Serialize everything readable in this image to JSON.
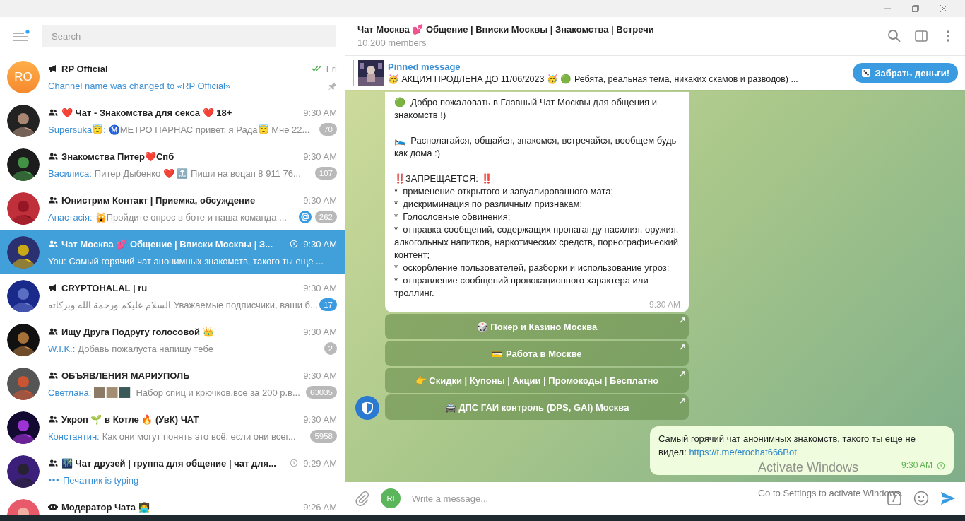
{
  "search": {
    "placeholder": "Search"
  },
  "menu": {
    "has_update": true
  },
  "chats": [
    {
      "name": "RP Official",
      "kind": "channel",
      "avatar": {
        "kind": "initials",
        "text": "RO"
      },
      "time": "Fri",
      "receipt": {
        "kind": "read"
      },
      "preview": {
        "kind": "service",
        "text": "Channel name was changed to «RP Official»"
      },
      "mention": false,
      "pinned": true,
      "selected": false
    },
    {
      "name": "❤️ Чат - Знакомства для секса ❤️ 18+",
      "kind": "group",
      "time": "9:30 AM",
      "preview": {
        "kind": "text",
        "sender": "Supersuka😇:",
        "text": "Ⓜ️МЕТРО ПАРНАС  привет, я Рада😇  Мне 22..."
      },
      "badge": "70",
      "badge_muted": true,
      "mention": false,
      "pinned": false,
      "selected": false
    },
    {
      "name": "Знакомства Питер❤️Спб",
      "kind": "group",
      "time": "9:30 AM",
      "preview": {
        "kind": "text",
        "sender": "Василиса:",
        "text": "Питер  Дыбенко ❤️ 🔝 Пиши на воцап  8 911 76..."
      },
      "badge": "107",
      "badge_muted": true,
      "mention": false,
      "pinned": false,
      "selected": false
    },
    {
      "name": "Юнистрим Контакт | Приемка, обсуждение",
      "kind": "group",
      "time": "9:30 AM",
      "preview": {
        "kind": "text",
        "sender": "Анастасія:",
        "text": "🙀Пройдите опрос в боте и наша команда ..."
      },
      "badge": "262",
      "badge_muted": true,
      "mention": true,
      "pinned": false,
      "selected": false
    },
    {
      "name": "Чат Москва 💕 Общение | Вписки Москвы | З...",
      "kind": "group",
      "time": "9:30 AM",
      "receipt": {
        "kind": "sending"
      },
      "preview": {
        "kind": "text",
        "sender": "You:",
        "text": "Самый горячий чат анонимных знакомств, такого ты еще ..."
      },
      "mention": false,
      "pinned": false,
      "selected": true
    },
    {
      "name": "CRYPTOHALAL | ru",
      "kind": "channel",
      "time": "9:30 AM",
      "preview": {
        "kind": "text",
        "text": "السلام عليكم ورحمة الله وبركاته  Уважаемые подписчики, ваши б..."
      },
      "badge": "17",
      "badge_muted": false,
      "mention": false,
      "pinned": false,
      "selected": false
    },
    {
      "name": "Ищу Друга Подругу голосовой 👑",
      "kind": "group",
      "time": "9:30 AM",
      "preview": {
        "kind": "text",
        "sender": "W.I.K.:",
        "text": "Добавь пожалуста напишу тебе"
      },
      "badge": "2",
      "badge_muted": true,
      "mention": false,
      "pinned": false,
      "selected": false
    },
    {
      "name": "ОБЪЯВЛЕНИЯ МАРИУПОЛЬ",
      "kind": "group",
      "time": "9:30 AM",
      "preview": {
        "kind": "media",
        "sender": "Светлана:",
        "text": "Набор спиц и крючков.все за 200 р.в..."
      },
      "badge": "63035",
      "badge_muted": true,
      "mention": false,
      "pinned": false,
      "selected": false
    },
    {
      "name": "Укроп 🌱 в Котле 🔥 (УвК) ЧАТ",
      "kind": "group",
      "time": "9:30 AM",
      "preview": {
        "kind": "text",
        "sender": "Константин:",
        "text": "Как они могут понять это всё, если они всег..."
      },
      "badge": "5958",
      "badge_muted": true,
      "mention": false,
      "pinned": false,
      "selected": false
    },
    {
      "name": "🌃 Чат друзей | группа для общение | чат для...",
      "kind": "group",
      "time": "9:29 AM",
      "receipt": {
        "kind": "sending"
      },
      "preview": {
        "kind": "typing",
        "text": "Печатник is typing"
      },
      "mention": false,
      "pinned": false,
      "selected": false
    },
    {
      "name": "Модератор Чата 👨‍💻",
      "kind": "bot",
      "time": "9:26 AM",
      "mention": false,
      "pinned": false,
      "selected": false
    }
  ],
  "chat": {
    "title": "Чат Москва 💕 Общение | Вписки Москвы | Знакомства | Встречи",
    "subtitle": "10,200 members",
    "pinned": {
      "label": "Pinned message",
      "text": "🥳 АКЦИЯ ПРОДЛЕНА ДО 11/06/2023 🥳  🟢  Ребята, реальная тема, никаких скамов и разводов) ...",
      "button": "Забрать деньги!"
    },
    "incoming": {
      "text": "🟢  Добро пожаловать в Главный Чат Москвы для общения и знакомств !)\n\n🛌  Располагайся, общайся, знакомся, встречайся, вообщем будь как дома :)\n\n‼️ЗАПРЕЩАЕТСЯ: ‼️\n*  применение открытого и завуалированного мата;\n*  дискриминация по различным признакам;\n*  Голословные обвинения;\n*  отправка сообщений, содержащих пропаганду насилия, оружия, алкогольных напитков, наркотических средств, порнографический контент;\n*  оскорбление пользователей, разборки и использование угроз;\n*  отправление сообщений провокационного характера или троллинг.",
      "time": "9:30 AM",
      "buttons": [
        "🎲 Покер и Казино Москва",
        "💳 Работа в Москве",
        "👉 Скидки | Купоны | Акции | Промокоды | Бесплатно",
        "🚔 ДПС ГАИ контроль (DPS, GAI) Москва"
      ]
    },
    "outgoing": {
      "text": "Самый горячий чат анонимных знакомств, такого ты еще не видел: ",
      "link": "https://t.me/erochat666Bot",
      "time": "9:30 AM",
      "receipt": {
        "kind": "sending"
      }
    },
    "composer": {
      "avatar": "RI",
      "placeholder": "Write a message..."
    }
  },
  "os_overlay": {
    "title": "Activate Windows",
    "subtitle": "Go to Settings to activate Windows."
  }
}
